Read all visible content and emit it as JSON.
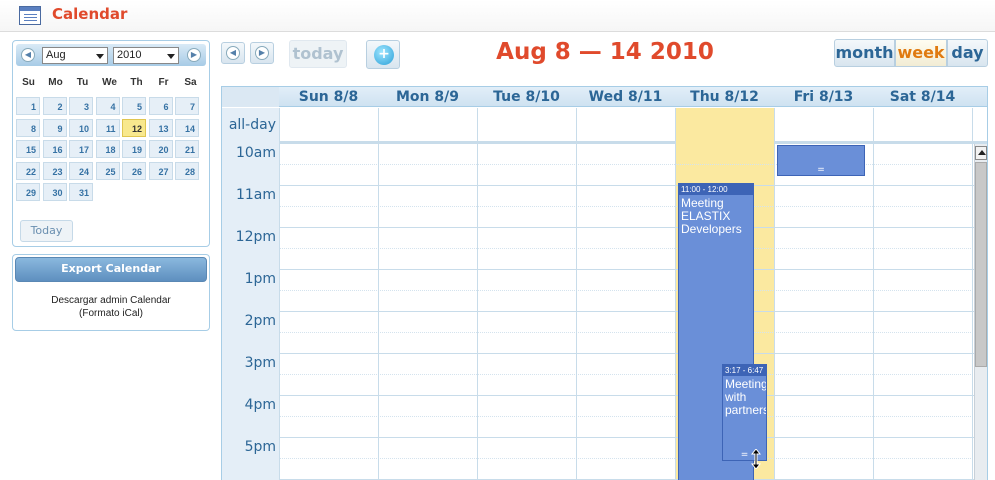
{
  "app": {
    "title": "Calendar"
  },
  "mini": {
    "month": "Aug",
    "year": "2010",
    "dow": [
      "Su",
      "Mo",
      "Tu",
      "We",
      "Th",
      "Fr",
      "Sa"
    ],
    "weeks": [
      [
        "1",
        "2",
        "3",
        "4",
        "5",
        "6",
        "7"
      ],
      [
        "8",
        "9",
        "10",
        "11",
        "12",
        "13",
        "14"
      ],
      [
        "15",
        "16",
        "17",
        "18",
        "19",
        "20",
        "21"
      ],
      [
        "22",
        "23",
        "24",
        "25",
        "26",
        "27",
        "28"
      ],
      [
        "29",
        "30",
        "31",
        "",
        "",
        "",
        ""
      ]
    ],
    "today_day": "12",
    "today_label": "Today"
  },
  "export": {
    "button": "Export Calendar",
    "line1": "Descargar admin Calendar",
    "line2": "(Formato iCal)"
  },
  "toolbar": {
    "today": "today",
    "range": "Aug 8 — 14 2010",
    "views": [
      "month",
      "week",
      "day"
    ],
    "active_view": "week"
  },
  "week": {
    "days": [
      "Sun 8/8",
      "Mon 8/9",
      "Tue 8/10",
      "Wed 8/11",
      "Thu 8/12",
      "Fri 8/13",
      "Sat 8/14"
    ],
    "allday_label": "all-day",
    "times": [
      "10am",
      "11am",
      "12pm",
      "1pm",
      "2pm",
      "3pm",
      "4pm",
      "5pm"
    ]
  },
  "events": [
    {
      "time": "11:00 - 12:00",
      "title": "Meeting ELASTIX Developers"
    },
    {
      "time": "3:17 - 6:47",
      "title": "Meeting with partners"
    },
    {
      "time": "",
      "title": ""
    }
  ],
  "colors": {
    "accent": "#e04a2c",
    "event": "#6a8fd8",
    "today": "#fbe9a0",
    "link": "#2c6696"
  }
}
